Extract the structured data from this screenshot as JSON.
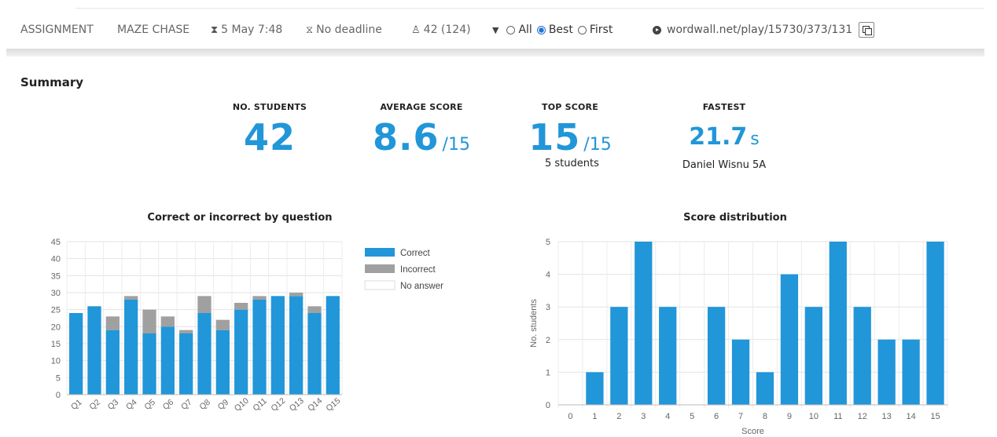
{
  "infobar": {
    "assignment": "ASSIGNMENT",
    "template": "MAZE CHASE",
    "start_date": "5 May 7:48",
    "deadline": "No deadline",
    "count": "42 (124)",
    "filter_options": [
      "All",
      "Best",
      "First"
    ],
    "filter_selected": "Best",
    "url": "wordwall.net/play/15730/373/131"
  },
  "summary": {
    "title": "Summary",
    "students_label": "NO. STUDENTS",
    "students_value": "42",
    "avg_label": "AVERAGE SCORE",
    "avg_value": "8.6",
    "avg_suffix": "/15",
    "top_label": "TOP SCORE",
    "top_value": "15",
    "top_suffix": "/15",
    "top_sub": "5 students",
    "fast_label": "FASTEST",
    "fast_value": "21.7",
    "fast_suffix": "s",
    "fast_sub": "Daniel Wisnu 5A"
  },
  "colors": {
    "correct": "#2196d8",
    "incorrect": "#a0a0a0",
    "no_answer": "#ffffff",
    "accent": "#2196d8"
  },
  "chart_data": [
    {
      "type": "bar",
      "title": "Correct or incorrect by question",
      "categories": [
        "Q1",
        "Q2",
        "Q3",
        "Q4",
        "Q5",
        "Q6",
        "Q7",
        "Q8",
        "Q9",
        "Q10",
        "Q11",
        "Q12",
        "Q13",
        "Q14",
        "Q15"
      ],
      "stacked": true,
      "series": [
        {
          "name": "Correct",
          "values": [
            24,
            26,
            19,
            28,
            18,
            20,
            18,
            24,
            19,
            25,
            28,
            29,
            29,
            24,
            29
          ]
        },
        {
          "name": "Incorrect",
          "values": [
            0,
            0,
            4,
            1,
            7,
            3,
            1,
            5,
            3,
            2,
            1,
            0,
            1,
            2,
            0
          ]
        },
        {
          "name": "No answer",
          "values": [
            0,
            0,
            0,
            0,
            0,
            0,
            0,
            0,
            0,
            0,
            0,
            0,
            0,
            0,
            0
          ]
        }
      ],
      "ylim": [
        0,
        45
      ],
      "yticks": [
        0,
        5,
        10,
        15,
        20,
        25,
        30,
        35,
        40,
        45
      ],
      "grid": true,
      "legend": "right"
    },
    {
      "type": "bar",
      "title": "Score distribution",
      "xlabel": "Score",
      "ylabel": "No. students",
      "categories": [
        "0",
        "1",
        "2",
        "3",
        "4",
        "5",
        "6",
        "7",
        "8",
        "9",
        "10",
        "11",
        "12",
        "13",
        "14",
        "15"
      ],
      "values": [
        0,
        1,
        3,
        5,
        3,
        0,
        3,
        2,
        1,
        4,
        3,
        5,
        3,
        2,
        2,
        5
      ],
      "ylim": [
        0,
        5
      ],
      "yticks": [
        0,
        1,
        2,
        3,
        4,
        5
      ],
      "grid": true
    }
  ]
}
